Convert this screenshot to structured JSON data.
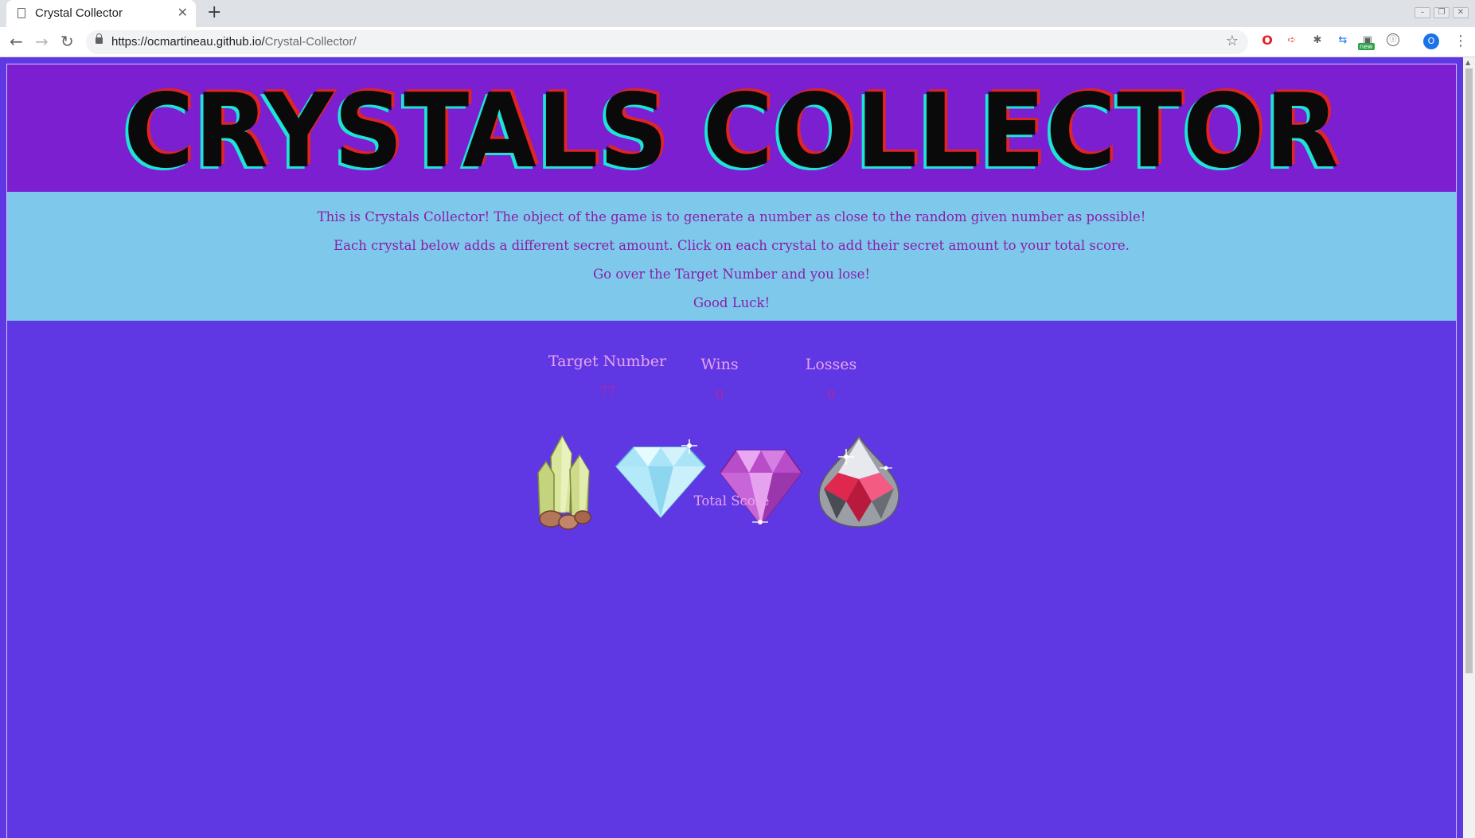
{
  "browser": {
    "tab_title": "Crystal Collector",
    "url_host": "https://ocmartineau.github.io/",
    "url_path": "Crystal-Collector/",
    "extension_badge": "new",
    "profile_initial": "O"
  },
  "header": {
    "title": "CRYSTALS COLLECTOR"
  },
  "intro": {
    "line1": "This is Crystals Collector! The object of the game is to generate a number as close to the random given number as possible!",
    "line2": "Each crystal below adds a different secret amount. Click on each crystal to add their secret amount to your total score.",
    "line3": "Go over the Target Number and you lose!",
    "line4": "Good Luck!"
  },
  "stats": {
    "target_label": "Target Number",
    "target_value": "77",
    "wins_label": "Wins",
    "wins_value": "0",
    "losses_label": "Losses",
    "losses_value": "0"
  },
  "crystals": [
    {
      "name": "green-quartz-crystal-icon",
      "color": "#c8d98a"
    },
    {
      "name": "clear-diamond-icon",
      "color": "#bfe9f7"
    },
    {
      "name": "purple-diamond-icon",
      "color": "#c766d6"
    },
    {
      "name": "red-teardrop-crystal-icon",
      "color": "#e0284f"
    }
  ],
  "total": {
    "label": "Total Score"
  },
  "colors": {
    "page_bg": "#5f38e3",
    "header_bg": "#7b1fd0",
    "intro_bg": "#7ec8ec",
    "intro_text": "#8a1ea8",
    "label_text": "#e8a3f0",
    "value_text": "#b0299d"
  }
}
